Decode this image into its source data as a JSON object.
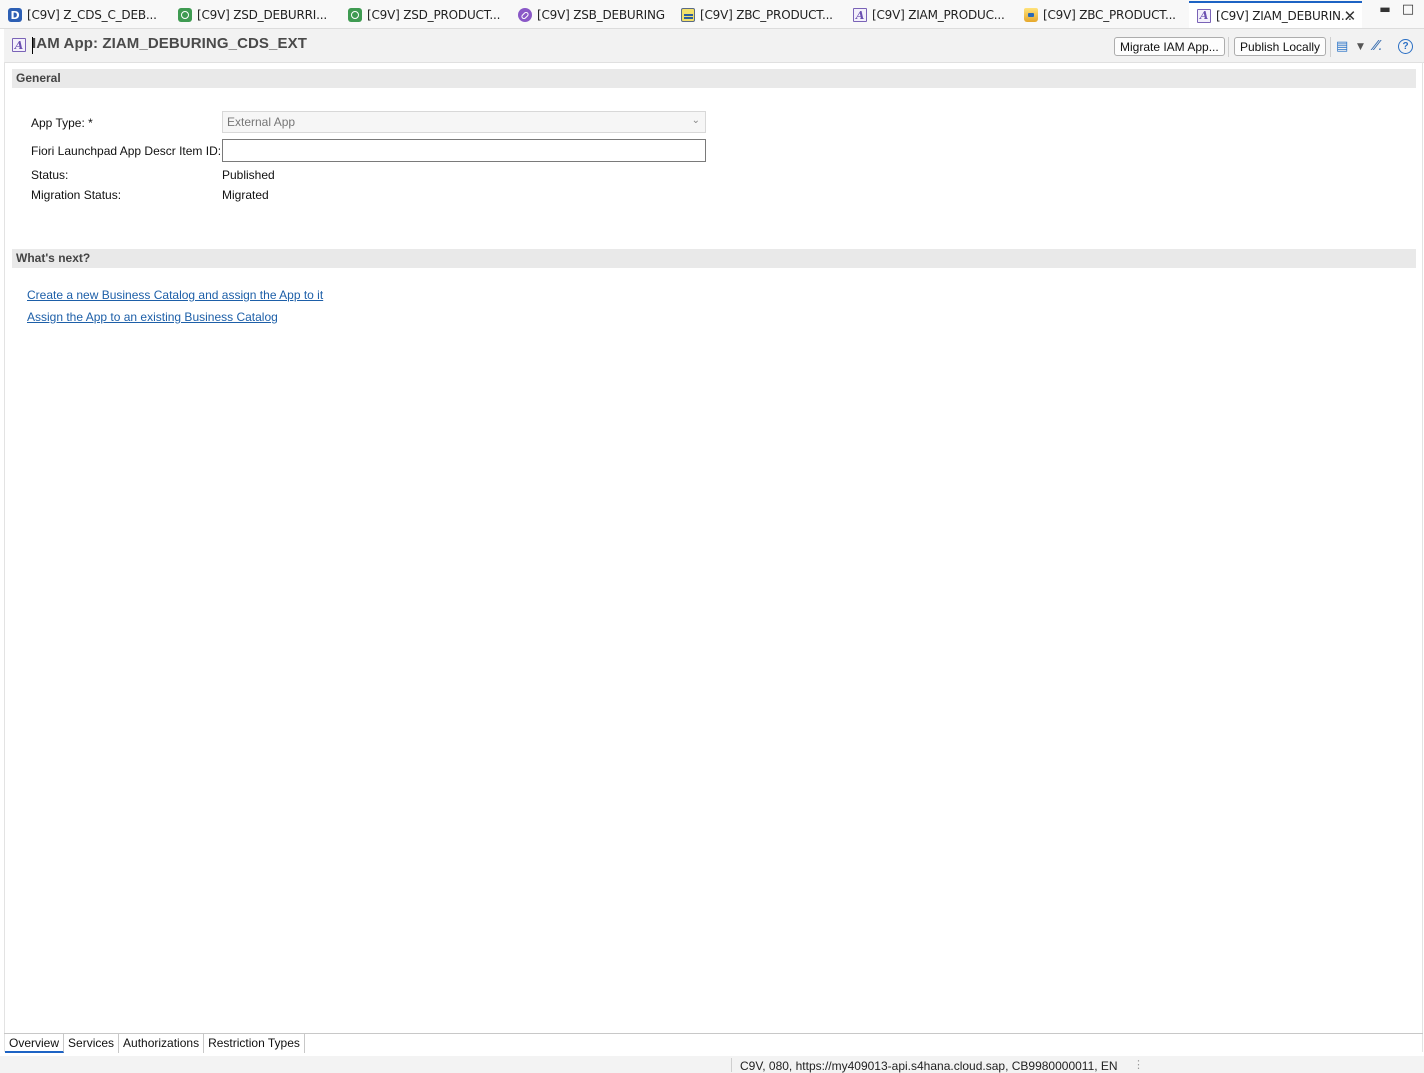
{
  "tabs": [
    {
      "label": "[C9V] Z_CDS_C_DEB...",
      "icon": "ddl-source-icon"
    },
    {
      "label": "[C9V] ZSD_DEBURRI...",
      "icon": "service-definition-icon"
    },
    {
      "label": "[C9V] ZSD_PRODUCT...",
      "icon": "service-definition-icon"
    },
    {
      "label": "[C9V] ZSB_DEBURING",
      "icon": "service-binding-icon"
    },
    {
      "label": "[C9V] ZBC_PRODUCT...",
      "icon": "business-catalog-icon"
    },
    {
      "label": "[C9V] ZIAM_PRODUC...",
      "icon": "iam-app-icon"
    },
    {
      "label": "[C9V] ZBC_PRODUCT...",
      "icon": "business-role-icon"
    },
    {
      "label": "[C9V] ZIAM_DEBURIN...",
      "icon": "iam-app-icon",
      "active": true
    }
  ],
  "header": {
    "title": "IAM App: ZIAM_DEBURING_CDS_EXT",
    "migrate_label": "Migrate IAM App...",
    "publish_label": "Publish Locally"
  },
  "general": {
    "section_title": "General",
    "app_type_label": "App Type: *",
    "app_type_value": "External App",
    "fiori_id_label": "Fiori Launchpad App Descr Item ID:",
    "fiori_id_value": "",
    "status_label": "Status:",
    "status_value": "Published",
    "migration_label": "Migration Status:",
    "migration_value": "Migrated"
  },
  "next": {
    "section_title": "What's next?",
    "link_create": "Create a new Business Catalog and assign the App to it",
    "link_assign": "Assign the App to an existing Business Catalog"
  },
  "page_tabs": [
    "Overview",
    "Services",
    "Authorizations",
    "Restriction Types"
  ],
  "status_bar": "C9V, 080, https://my409013-api.s4hana.cloud.sap, CB9980000011, EN",
  "colors": {
    "accent": "#1d63c4",
    "link": "#1d5fa8",
    "section_bg": "#e9e9e9"
  }
}
